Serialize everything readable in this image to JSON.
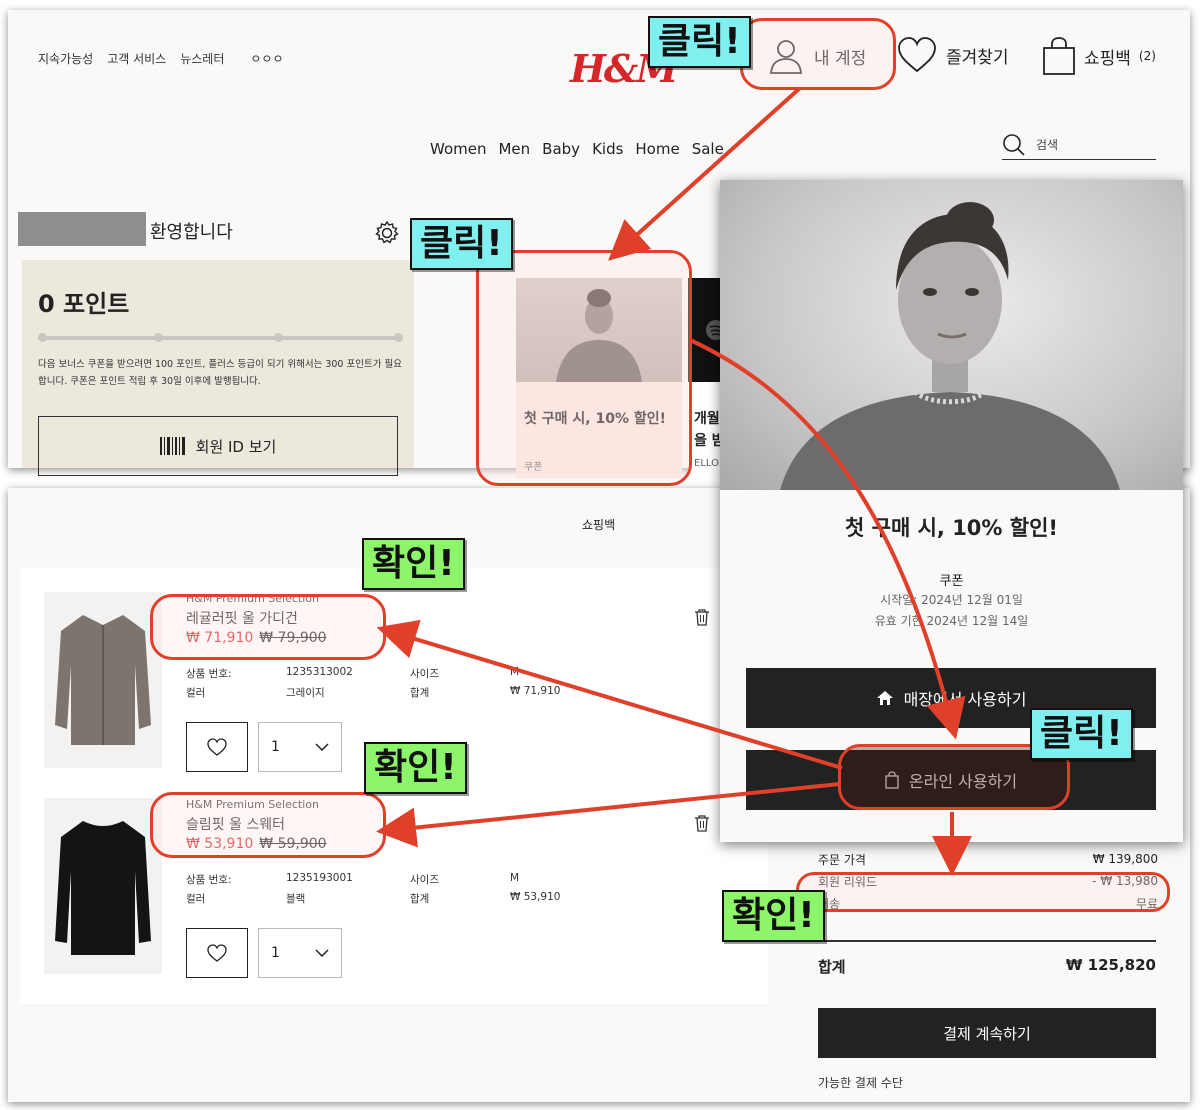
{
  "home": {
    "top_links": [
      "지속가능성",
      "고객 서비스",
      "뉴스레터",
      "ㅇㅇㅇ"
    ],
    "logo": "H&M",
    "account_label": "내 계정",
    "favorites_label": "즐겨찾기",
    "bag_label": "쇼핑백",
    "bag_count": "(2)",
    "nav": [
      "Women",
      "Men",
      "Baby",
      "Kids",
      "Home",
      "Sale"
    ],
    "search_placeholder": "검색",
    "welcome": "환영합니다",
    "points_title": "0 포인트",
    "points_desc": "다음 보너스 쿠폰을 받으려면 100 포인트, 플러스 등급이 되기 위해서는 300 포인트가 필요합니다. 쿠폰은 포인트 적립 후 30일 이후에 발행됩니다.",
    "member_id_button": "회원 ID 보기",
    "offer_title": "첫 구매 시, 10% 할인!",
    "offer_tag": "쿠폰",
    "offer2_text_1": "개월",
    "offer2_text_2": "을 받",
    "offer2_tag": "ELLO"
  },
  "cart": {
    "title": "쇼핑백",
    "items": [
      {
        "brand": "H&M Premium Selection",
        "name": "레귤러핏 울 가디건",
        "price_sale": "₩ 71,910",
        "price_original": "₩ 79,900",
        "spec_labels": [
          "상품 번호:",
          "컬러",
          "사이즈",
          "합계"
        ],
        "article_no": "1235313002",
        "color": "그레이지",
        "size": "M",
        "total": "₩ 71,910",
        "qty": "1"
      },
      {
        "brand": "H&M Premium Selection",
        "name": "슬림핏 울 스웨터",
        "price_sale": "₩ 53,910",
        "price_original": "₩ 59,900",
        "spec_labels": [
          "상품 번호:",
          "컬러",
          "사이즈",
          "합계"
        ],
        "article_no": "1235193001",
        "color": "블랙",
        "size": "M",
        "total": "₩ 53,910",
        "qty": "1"
      }
    ],
    "summary": {
      "order_value_label": "주문 가격",
      "order_value": "₩ 139,800",
      "reward_label": "회원 리워드",
      "reward_value": "- ₩ 13,980",
      "delivery_label": "배송",
      "delivery_value": "무료",
      "total_label": "합계",
      "total_value": "₩ 125,820",
      "checkout_button": "결제 계속하기",
      "payment_methods": "가능한 결제 수단"
    }
  },
  "coupon": {
    "title": "첫 구매 시, 10% 할인!",
    "type": "쿠폰",
    "start": "시작일: 2024년 12월 01일",
    "expiry": "유효 기한 2024년 12월 14일",
    "store_button": "매장에서 사용하기",
    "online_button": "온라인 사용하기"
  },
  "annotations": {
    "click": "클릭!",
    "confirm": "확인!"
  },
  "colors": {
    "brand_red": "#d6262a",
    "highlight_red": "#e0402a",
    "label_blue": "#7ff0ef",
    "label_green": "#8cf56a"
  }
}
